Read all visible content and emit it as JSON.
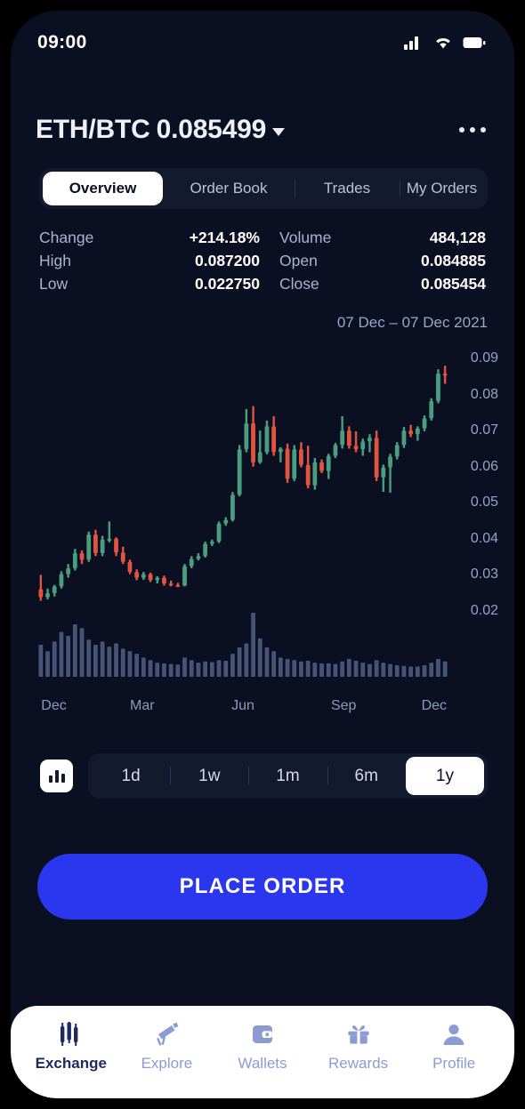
{
  "status_bar": {
    "time": "09:00",
    "icons": [
      "signal-icon",
      "wifi-icon",
      "battery-icon"
    ]
  },
  "header": {
    "pair": "ETH/BTC",
    "price": "0.085499",
    "caret": "chevron-down-icon",
    "more": "more-options-icon"
  },
  "tabs": [
    {
      "label": "Overview",
      "active": true
    },
    {
      "label": "Order Book",
      "active": false
    },
    {
      "label": "Trades",
      "active": false
    },
    {
      "label": "My Orders",
      "active": false
    }
  ],
  "stats": {
    "change_label": "Change",
    "change_value": "+214.18%",
    "high_label": "High",
    "high_value": "0.087200",
    "low_label": "Low",
    "low_value": "0.022750",
    "volume_label": "Volume",
    "volume_value": "484,128",
    "open_label": "Open",
    "open_value": "0.084885",
    "close_label": "Close",
    "close_value": "0.085454"
  },
  "date_range": "07 Dec – 07 Dec 2021",
  "range_selector": {
    "chart_type_icon": "bar-chart-icon",
    "options": [
      {
        "label": "1d",
        "active": false
      },
      {
        "label": "1w",
        "active": false
      },
      {
        "label": "1m",
        "active": false
      },
      {
        "label": "6m",
        "active": false
      },
      {
        "label": "1y",
        "active": true
      }
    ]
  },
  "place_order_label": "PLACE ORDER",
  "bottom_nav": [
    {
      "label": "Exchange",
      "icon": "candlestick-icon",
      "active": true
    },
    {
      "label": "Explore",
      "icon": "telescope-icon",
      "active": false
    },
    {
      "label": "Wallets",
      "icon": "wallet-icon",
      "active": false
    },
    {
      "label": "Rewards",
      "icon": "gift-icon",
      "active": false
    },
    {
      "label": "Profile",
      "icon": "person-icon",
      "active": false
    }
  ],
  "colors": {
    "background": "#0a1022",
    "accent": "#2a37ee",
    "candle_up": "#4a9e7f",
    "candle_down": "#e2543f",
    "volume_bar": "#475477",
    "axis_text": "#97a3c4"
  },
  "chart_data": {
    "type": "candlestick",
    "title": "ETH/BTC 1y price",
    "xlabel": "",
    "ylabel": "",
    "ylim": [
      0.018,
      0.092
    ],
    "yticks": [
      "0.09",
      "0.08",
      "0.07",
      "0.06",
      "0.05",
      "0.04",
      "0.03",
      "0.02"
    ],
    "ytick_values": [
      0.09,
      0.08,
      0.07,
      0.06,
      0.05,
      0.04,
      0.03,
      0.02
    ],
    "xticks": [
      "Dec",
      "Mar",
      "Jun",
      "Sep",
      "Dec"
    ],
    "xtick_positions": [
      0.04,
      0.255,
      0.5,
      0.745,
      0.965
    ],
    "grid": false,
    "legend": "none",
    "volume_max": 484128,
    "candles": [
      {
        "o": 0.026,
        "h": 0.03,
        "l": 0.0228,
        "c": 0.0238,
        "v": 0.5
      },
      {
        "o": 0.0238,
        "h": 0.0262,
        "l": 0.0232,
        "c": 0.0249,
        "v": 0.4
      },
      {
        "o": 0.0249,
        "h": 0.0272,
        "l": 0.024,
        "c": 0.0268,
        "v": 0.55
      },
      {
        "o": 0.0268,
        "h": 0.031,
        "l": 0.0262,
        "c": 0.0302,
        "v": 0.7
      },
      {
        "o": 0.0302,
        "h": 0.033,
        "l": 0.0292,
        "c": 0.0318,
        "v": 0.64
      },
      {
        "o": 0.0318,
        "h": 0.0372,
        "l": 0.0312,
        "c": 0.036,
        "v": 0.82
      },
      {
        "o": 0.036,
        "h": 0.0368,
        "l": 0.033,
        "c": 0.0342,
        "v": 0.76
      },
      {
        "o": 0.0342,
        "h": 0.042,
        "l": 0.0336,
        "c": 0.0412,
        "v": 0.58
      },
      {
        "o": 0.0412,
        "h": 0.0425,
        "l": 0.0352,
        "c": 0.036,
        "v": 0.5
      },
      {
        "o": 0.036,
        "h": 0.0408,
        "l": 0.0352,
        "c": 0.0398,
        "v": 0.55
      },
      {
        "o": 0.0398,
        "h": 0.0448,
        "l": 0.039,
        "c": 0.04,
        "v": 0.47
      },
      {
        "o": 0.04,
        "h": 0.0404,
        "l": 0.0352,
        "c": 0.0362,
        "v": 0.52
      },
      {
        "o": 0.0362,
        "h": 0.0378,
        "l": 0.033,
        "c": 0.0336,
        "v": 0.44
      },
      {
        "o": 0.0336,
        "h": 0.0342,
        "l": 0.0302,
        "c": 0.0308,
        "v": 0.4
      },
      {
        "o": 0.0308,
        "h": 0.0315,
        "l": 0.0285,
        "c": 0.0292,
        "v": 0.36
      },
      {
        "o": 0.0292,
        "h": 0.0308,
        "l": 0.0286,
        "c": 0.0302,
        "v": 0.3
      },
      {
        "o": 0.0302,
        "h": 0.0306,
        "l": 0.028,
        "c": 0.0285,
        "v": 0.26
      },
      {
        "o": 0.0285,
        "h": 0.0296,
        "l": 0.0276,
        "c": 0.0292,
        "v": 0.22
      },
      {
        "o": 0.0292,
        "h": 0.0298,
        "l": 0.027,
        "c": 0.0276,
        "v": 0.21
      },
      {
        "o": 0.0276,
        "h": 0.0284,
        "l": 0.0268,
        "c": 0.0272,
        "v": 0.2
      },
      {
        "o": 0.0272,
        "h": 0.0278,
        "l": 0.0266,
        "c": 0.027,
        "v": 0.19
      },
      {
        "o": 0.027,
        "h": 0.033,
        "l": 0.0268,
        "c": 0.0324,
        "v": 0.3
      },
      {
        "o": 0.0324,
        "h": 0.0352,
        "l": 0.0318,
        "c": 0.0344,
        "v": 0.26
      },
      {
        "o": 0.0344,
        "h": 0.036,
        "l": 0.034,
        "c": 0.0352,
        "v": 0.22
      },
      {
        "o": 0.0352,
        "h": 0.0392,
        "l": 0.0348,
        "c": 0.0386,
        "v": 0.24
      },
      {
        "o": 0.0386,
        "h": 0.0398,
        "l": 0.038,
        "c": 0.0392,
        "v": 0.23
      },
      {
        "o": 0.0392,
        "h": 0.0448,
        "l": 0.0388,
        "c": 0.0442,
        "v": 0.26
      },
      {
        "o": 0.0442,
        "h": 0.046,
        "l": 0.0436,
        "c": 0.0452,
        "v": 0.25
      },
      {
        "o": 0.0452,
        "h": 0.053,
        "l": 0.0448,
        "c": 0.0522,
        "v": 0.36
      },
      {
        "o": 0.0522,
        "h": 0.066,
        "l": 0.0518,
        "c": 0.0648,
        "v": 0.46
      },
      {
        "o": 0.0648,
        "h": 0.076,
        "l": 0.064,
        "c": 0.072,
        "v": 0.52
      },
      {
        "o": 0.072,
        "h": 0.0768,
        "l": 0.06,
        "c": 0.0612,
        "v": 1.0
      },
      {
        "o": 0.0612,
        "h": 0.07,
        "l": 0.0608,
        "c": 0.064,
        "v": 0.6
      },
      {
        "o": 0.064,
        "h": 0.0728,
        "l": 0.0634,
        "c": 0.0712,
        "v": 0.46
      },
      {
        "o": 0.0712,
        "h": 0.074,
        "l": 0.063,
        "c": 0.064,
        "v": 0.4
      },
      {
        "o": 0.064,
        "h": 0.0654,
        "l": 0.0612,
        "c": 0.065,
        "v": 0.3
      },
      {
        "o": 0.065,
        "h": 0.0664,
        "l": 0.0555,
        "c": 0.0566,
        "v": 0.28
      },
      {
        "o": 0.0566,
        "h": 0.066,
        "l": 0.056,
        "c": 0.0648,
        "v": 0.26
      },
      {
        "o": 0.0648,
        "h": 0.0668,
        "l": 0.0598,
        "c": 0.0605,
        "v": 0.24
      },
      {
        "o": 0.0605,
        "h": 0.0658,
        "l": 0.054,
        "c": 0.0548,
        "v": 0.25
      },
      {
        "o": 0.0548,
        "h": 0.0624,
        "l": 0.0536,
        "c": 0.0612,
        "v": 0.22
      },
      {
        "o": 0.0612,
        "h": 0.062,
        "l": 0.0582,
        "c": 0.0588,
        "v": 0.21
      },
      {
        "o": 0.0588,
        "h": 0.0636,
        "l": 0.0566,
        "c": 0.063,
        "v": 0.21
      },
      {
        "o": 0.063,
        "h": 0.0666,
        "l": 0.0624,
        "c": 0.066,
        "v": 0.2
      },
      {
        "o": 0.066,
        "h": 0.074,
        "l": 0.065,
        "c": 0.07,
        "v": 0.24
      },
      {
        "o": 0.07,
        "h": 0.0712,
        "l": 0.065,
        "c": 0.0658,
        "v": 0.28
      },
      {
        "o": 0.0658,
        "h": 0.0698,
        "l": 0.064,
        "c": 0.0648,
        "v": 0.25
      },
      {
        "o": 0.0648,
        "h": 0.0678,
        "l": 0.063,
        "c": 0.067,
        "v": 0.22
      },
      {
        "o": 0.067,
        "h": 0.069,
        "l": 0.064,
        "c": 0.068,
        "v": 0.2
      },
      {
        "o": 0.068,
        "h": 0.07,
        "l": 0.056,
        "c": 0.057,
        "v": 0.26
      },
      {
        "o": 0.057,
        "h": 0.0606,
        "l": 0.053,
        "c": 0.0598,
        "v": 0.22
      },
      {
        "o": 0.0598,
        "h": 0.0636,
        "l": 0.0528,
        "c": 0.0628,
        "v": 0.2
      },
      {
        "o": 0.0628,
        "h": 0.0668,
        "l": 0.062,
        "c": 0.066,
        "v": 0.18
      },
      {
        "o": 0.066,
        "h": 0.071,
        "l": 0.0652,
        "c": 0.07,
        "v": 0.17
      },
      {
        "o": 0.07,
        "h": 0.0716,
        "l": 0.0682,
        "c": 0.069,
        "v": 0.16
      },
      {
        "o": 0.069,
        "h": 0.0712,
        "l": 0.0672,
        "c": 0.0706,
        "v": 0.16
      },
      {
        "o": 0.0706,
        "h": 0.0742,
        "l": 0.0698,
        "c": 0.0734,
        "v": 0.18
      },
      {
        "o": 0.0734,
        "h": 0.079,
        "l": 0.0728,
        "c": 0.0782,
        "v": 0.22
      },
      {
        "o": 0.0782,
        "h": 0.087,
        "l": 0.0776,
        "c": 0.0858,
        "v": 0.28
      },
      {
        "o": 0.0858,
        "h": 0.088,
        "l": 0.083,
        "c": 0.0855,
        "v": 0.24
      }
    ]
  }
}
